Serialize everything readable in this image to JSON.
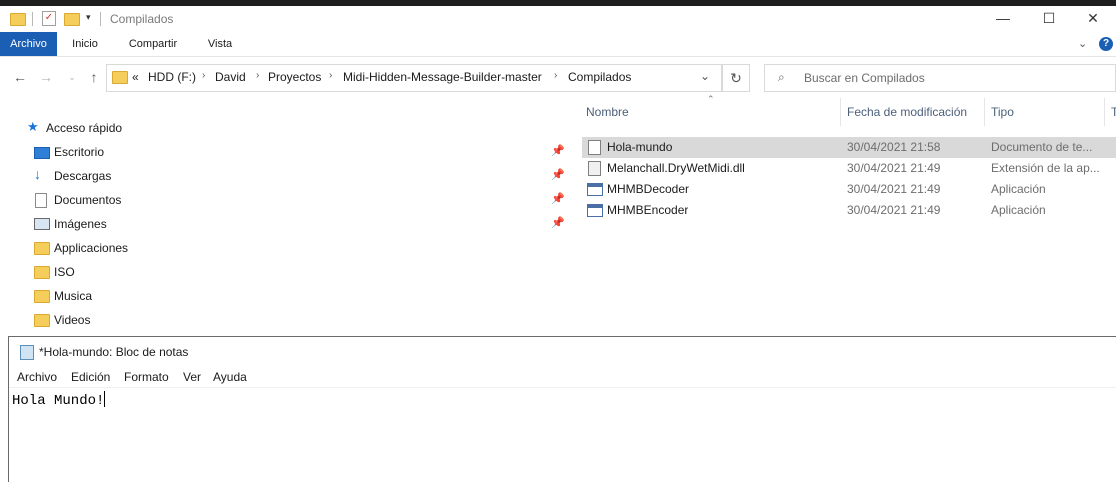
{
  "explorer": {
    "title": "Compilados",
    "ribbon_tabs": [
      "Archivo",
      "Inicio",
      "Compartir",
      "Vista"
    ],
    "address": {
      "overflow": "«",
      "crumbs": [
        "HDD (F:)",
        "David",
        "Proyectos",
        "Midi-Hidden-Message-Builder-master",
        "Compilados"
      ]
    },
    "search_placeholder": "Buscar en Compilados",
    "nav_items": [
      {
        "label": "Acceso rápido",
        "icon": "star-icon",
        "pinned": false
      },
      {
        "label": "Escritorio",
        "icon": "desktop-icon",
        "pinned": true
      },
      {
        "label": "Descargas",
        "icon": "download-icon",
        "pinned": true
      },
      {
        "label": "Documentos",
        "icon": "document-icon",
        "pinned": true
      },
      {
        "label": "Imágenes",
        "icon": "pictures-icon",
        "pinned": true
      },
      {
        "label": "Applicaciones",
        "icon": "folder-icon",
        "pinned": false
      },
      {
        "label": "ISO",
        "icon": "folder-icon",
        "pinned": false
      },
      {
        "label": "Musica",
        "icon": "folder-icon",
        "pinned": false
      },
      {
        "label": "Videos",
        "icon": "folder-icon",
        "pinned": false
      }
    ],
    "columns": [
      "Nombre",
      "Fecha de modificación",
      "Tipo",
      "T"
    ],
    "files": [
      {
        "name": "Hola-mundo",
        "date": "30/04/2021 21:58",
        "type": "Documento de te...",
        "icon": "text-file-icon",
        "selected": true
      },
      {
        "name": "Melanchall.DryWetMidi.dll",
        "date": "30/04/2021 21:49",
        "type": "Extensión de la ap...",
        "icon": "dll-file-icon",
        "selected": false
      },
      {
        "name": "MHMBDecoder",
        "date": "30/04/2021 21:49",
        "type": "Aplicación",
        "icon": "app-icon",
        "selected": false
      },
      {
        "name": "MHMBEncoder",
        "date": "30/04/2021 21:49",
        "type": "Aplicación",
        "icon": "app-icon",
        "selected": false
      }
    ],
    "accent_color": "#1a5fb4"
  },
  "notepad": {
    "title": "*Hola-mundo: Bloc de notas",
    "menu": [
      "Archivo",
      "Edición",
      "Formato",
      "Ver",
      "Ayuda"
    ],
    "content": "Hola Mundo!"
  }
}
